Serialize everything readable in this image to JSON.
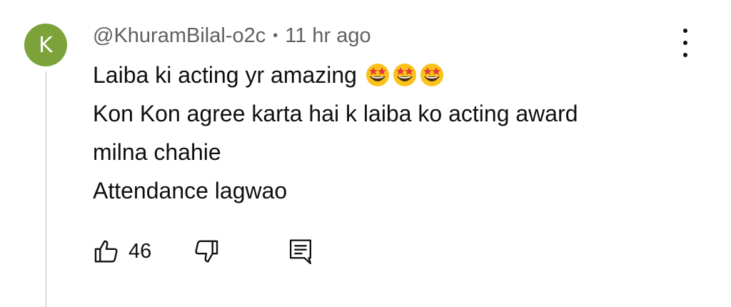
{
  "comment": {
    "avatar_letter": "K",
    "avatar_color": "#7ca33a",
    "author": "@KhuramBilal-o2c",
    "separator": "•",
    "timestamp": "11 hr ago",
    "lines": [
      "Laiba ki acting yr amazing",
      "Kon Kon agree karta hai k laiba ko acting award",
      "milna chahie",
      "Attendance lagwao"
    ],
    "emojis": [
      "star-struck-emoji",
      "star-struck-emoji",
      "star-struck-emoji"
    ],
    "like_count": "46",
    "icons": {
      "like": "thumbs-up-icon",
      "dislike": "thumbs-down-icon",
      "reply": "comment-reply-icon",
      "menu": "more-vertical-icon"
    }
  }
}
